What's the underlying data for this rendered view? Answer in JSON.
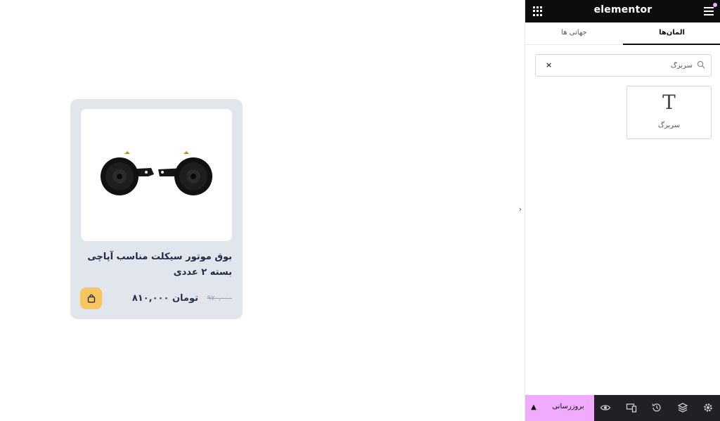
{
  "product": {
    "title": "بوق موتور سیکلت مناسب آپاچی بسته ۲ عددی",
    "price_new": "۸۱۰,۰۰۰ تومان",
    "price_old": "۹۷۰,۰۰۰",
    "image_icon": "motorcycle-horn-image",
    "cart_icon": "bag-icon",
    "cart_color": "#f5c662"
  },
  "panel": {
    "logo": "elementor",
    "tabs": [
      {
        "label": "المان‌ها",
        "active": true
      },
      {
        "label": "جهانی ها",
        "active": false
      }
    ],
    "search": {
      "value": "سربرگ",
      "clear": "×"
    },
    "widgets": [
      {
        "label": "سربرگ",
        "icon": "heading-T-icon"
      }
    ],
    "bottom": {
      "publish_label": "بروزرسانی",
      "icons": [
        "settings-icon",
        "layers-icon",
        "history-icon",
        "responsive-icon",
        "preview-eye-icon"
      ]
    },
    "accent": "#f0abfc"
  }
}
